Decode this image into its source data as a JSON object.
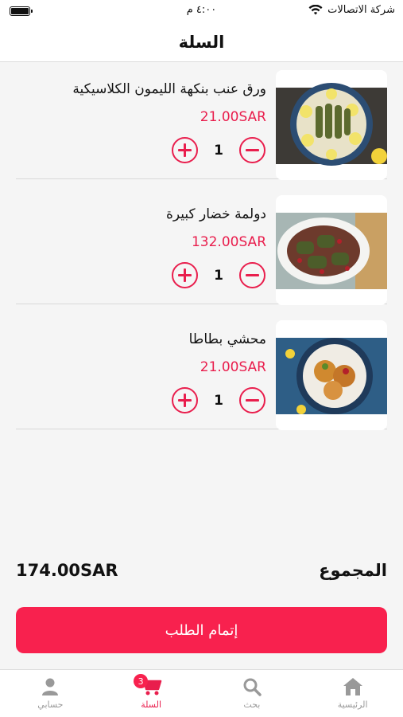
{
  "status_bar": {
    "carrier": "شركة الاتصالات",
    "time": "٤:٠٠ م"
  },
  "header": {
    "title": "السلة"
  },
  "cart": {
    "items": [
      {
        "name": "ورق عنب بنكهة الليمون الكلاسيكية",
        "price": "21.00SAR",
        "quantity": "1",
        "image": "grape-leaves-dish"
      },
      {
        "name": "دولمة خضار كبيرة",
        "price": "132.00SAR",
        "quantity": "1",
        "image": "vegetable-dolma-dish"
      },
      {
        "name": "محشي بطاطا",
        "price": "21.00SAR",
        "quantity": "1",
        "image": "stuffed-potato-dish"
      }
    ]
  },
  "summary": {
    "total_label": "المجموع",
    "total_value": "174.00SAR",
    "checkout_label": "إتمام الطلب"
  },
  "tabbar": {
    "items": [
      {
        "label": "الرئيسية",
        "icon": "home-icon"
      },
      {
        "label": "بحث",
        "icon": "search-icon"
      },
      {
        "label": "السلة",
        "icon": "cart-icon",
        "badge": "3"
      },
      {
        "label": "حسابي",
        "icon": "user-icon"
      }
    ]
  },
  "colors": {
    "accent": "#f8214e",
    "price": "#e91e4d",
    "inactive_tab": "#999999"
  }
}
